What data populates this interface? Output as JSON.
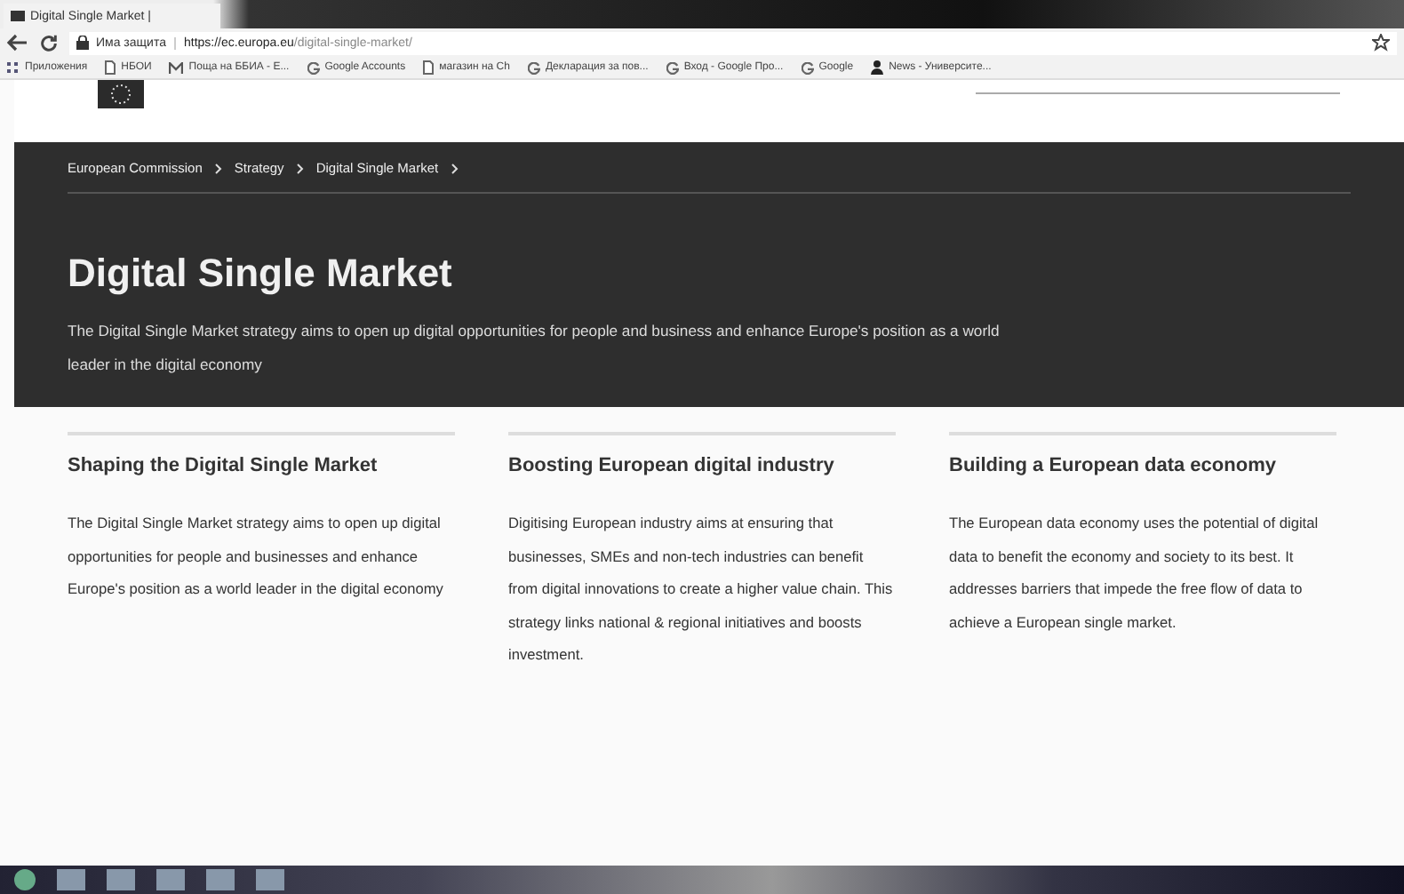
{
  "browser": {
    "tab_title": "Digital Single Market |",
    "security": "Има защита",
    "url_host": "https://ec.europa.eu",
    "url_path": "/digital-single-market/",
    "bookmarks": [
      {
        "label": "Приложения",
        "kind": "apps"
      },
      {
        "label": "НБОИ",
        "kind": "page"
      },
      {
        "label": "Поща на ББИА - Е...",
        "kind": "mail"
      },
      {
        "label": "Google Accounts",
        "kind": "google"
      },
      {
        "label": "магазин на Ch",
        "kind": "page"
      },
      {
        "label": "Декларация за пов...",
        "kind": "google"
      },
      {
        "label": "Вход - Google Про...",
        "kind": "google"
      },
      {
        "label": "Google",
        "kind": "google"
      },
      {
        "label": "News - Университе...",
        "kind": "person"
      }
    ]
  },
  "breadcrumb": [
    "European Commission",
    "Strategy",
    "Digital Single Market"
  ],
  "hero": {
    "title": "Digital Single Market",
    "text": "The Digital Single Market strategy aims to open up digital opportunities for people and business and enhance Europe's position as a world leader in the digital economy"
  },
  "columns": [
    {
      "title": "Shaping the Digital Single Market",
      "text": "The Digital Single Market strategy aims to open up digital opportunities for people and businesses and enhance Europe's position as a world leader in the digital economy"
    },
    {
      "title": "Boosting European digital industry",
      "text": "Digitising European industry aims at ensuring that businesses, SMEs and non-tech industries can benefit from digital innovations to create a higher value chain. This strategy links national & regional initiatives and boosts investment."
    },
    {
      "title": "Building a European data economy",
      "text": "The European data economy uses the potential of digital data to benefit the economy and society to its best. It addresses barriers that impede the free flow of data to achieve a European single market."
    }
  ]
}
